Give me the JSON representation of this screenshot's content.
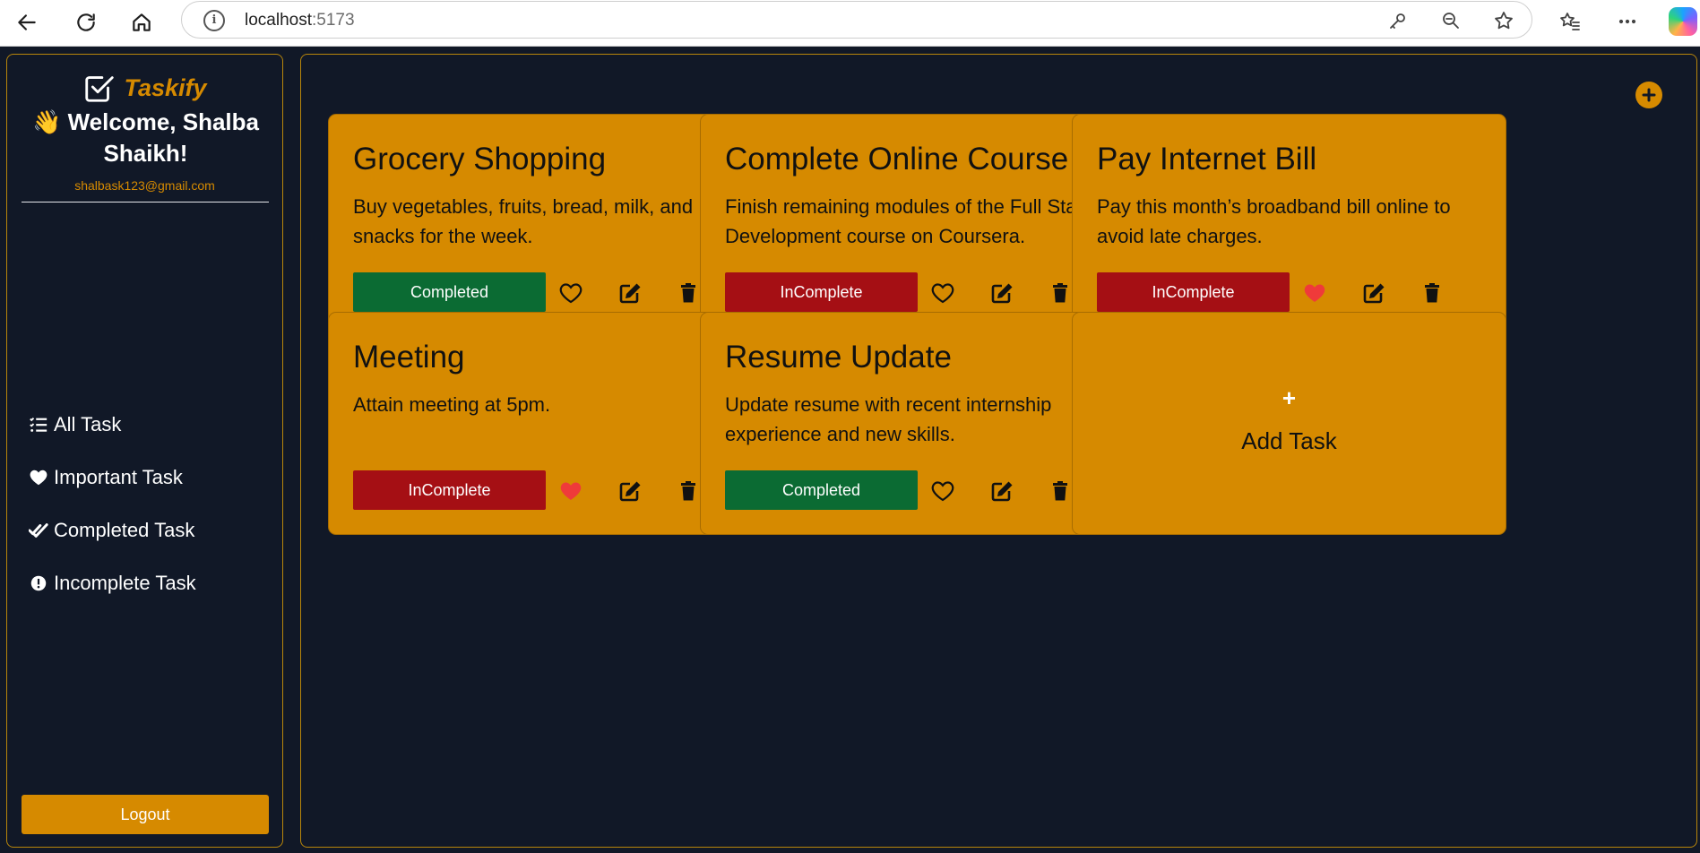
{
  "browser": {
    "url_host": "localhost",
    "url_port": ":5173"
  },
  "sidebar": {
    "brand": "Taskify",
    "welcome": "👋 Welcome, Shalba Shaikh!",
    "email": "shalbask123@gmail.com",
    "menu": [
      {
        "label": "All Task",
        "icon": "list-check-icon"
      },
      {
        "label": "Important Task",
        "icon": "heart-icon"
      },
      {
        "label": "Completed Task",
        "icon": "double-check-icon"
      },
      {
        "label": "Incomplete Task",
        "icon": "exclamation-circle-icon"
      }
    ],
    "logout": "Logout"
  },
  "tasks": [
    {
      "title": "Grocery Shopping",
      "desc": "Buy vegetables, fruits, bread, milk, and snacks for the week.",
      "status": "Completed",
      "important": false
    },
    {
      "title": "Complete Online Course",
      "desc": "Finish remaining modules of the Full Stack Development course on Coursera.",
      "status": "InComplete",
      "important": false
    },
    {
      "title": "Pay Internet Bill",
      "desc": "Pay this month’s broadband bill online to avoid late charges.",
      "status": "InComplete",
      "important": true
    },
    {
      "title": "Meeting",
      "desc": "Attain meeting at 5pm.",
      "status": "InComplete",
      "important": true
    },
    {
      "title": "Resume Update",
      "desc": "Update resume with recent internship experience and new skills.",
      "status": "Completed",
      "important": false
    }
  ],
  "add_card": {
    "plus": "+",
    "label": "Add Task"
  },
  "colors": {
    "accent": "#d68a00",
    "background": "#111827",
    "completed": "#0b6b33",
    "incomplete": "#a50f14",
    "heart_active": "#ef3a3a"
  }
}
